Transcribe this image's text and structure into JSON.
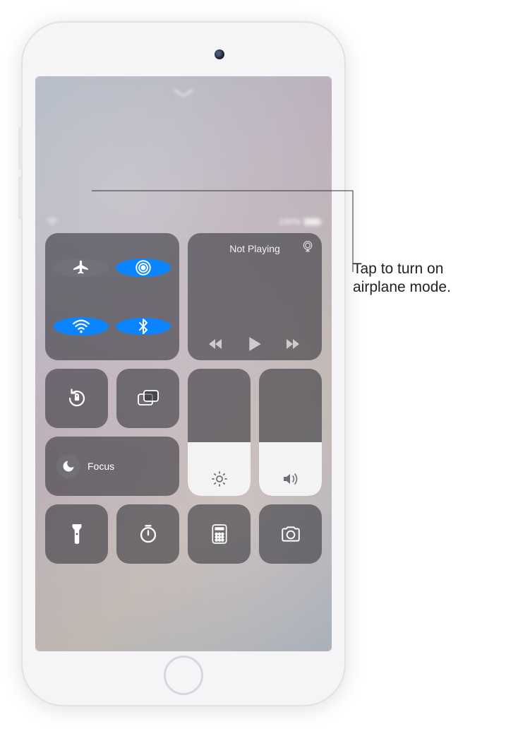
{
  "statusbar": {
    "battery_percent": "100%"
  },
  "connectivity": {
    "airplane_mode": {
      "name": "airplane-mode",
      "active": false
    },
    "airdrop": {
      "name": "airdrop",
      "active": true
    },
    "wifi": {
      "name": "wifi",
      "active": true
    },
    "bluetooth": {
      "name": "bluetooth",
      "active": true
    }
  },
  "media": {
    "title": "Not Playing",
    "playing": false
  },
  "focus": {
    "label": "Focus",
    "active": false
  },
  "sliders": {
    "brightness": {
      "level_percent": 42
    },
    "volume": {
      "level_percent": 42
    }
  },
  "tiles": {
    "orientation_lock": "orientation-lock",
    "screen_mirroring": "screen-mirroring",
    "flashlight": "flashlight",
    "timer": "timer",
    "calculator": "calculator",
    "camera": "camera"
  },
  "callout": {
    "line1": "Tap to turn on",
    "line2": "airplane mode."
  }
}
